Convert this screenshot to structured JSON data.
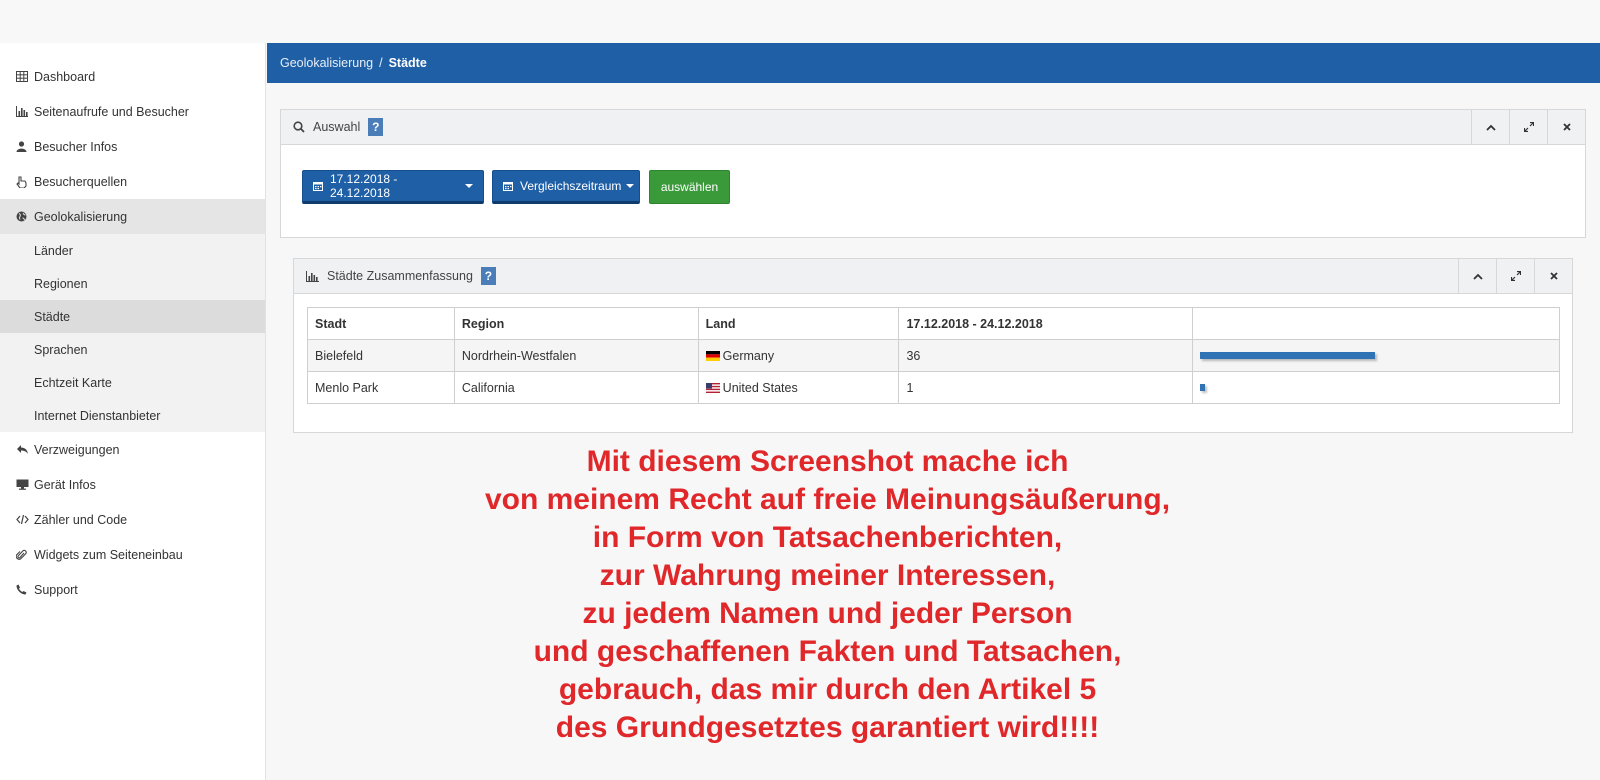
{
  "sidebar": {
    "items": [
      {
        "label": "Dashboard",
        "icon": "table-icon"
      },
      {
        "label": "Seitenaufrufe und Besucher",
        "icon": "bar-chart-icon"
      },
      {
        "label": "Besucher Infos",
        "icon": "user-icon"
      },
      {
        "label": "Besucherquellen",
        "icon": "hand-pointer-icon"
      },
      {
        "label": "Geolokalisierung",
        "icon": "globe-icon"
      }
    ],
    "subitems": [
      {
        "label": "Länder"
      },
      {
        "label": "Regionen"
      },
      {
        "label": "Städte"
      },
      {
        "label": "Sprachen"
      },
      {
        "label": "Echtzeit Karte"
      },
      {
        "label": "Internet Dienstanbieter"
      }
    ],
    "items2": [
      {
        "label": "Verzweigungen",
        "icon": "reply-all-icon"
      },
      {
        "label": "Gerät Infos",
        "icon": "desktop-icon"
      },
      {
        "label": "Zähler und Code",
        "icon": "code-icon"
      },
      {
        "label": "Widgets zum Seiteneinbau",
        "icon": "paperclip-icon"
      },
      {
        "label": "Support",
        "icon": "phone-icon"
      }
    ]
  },
  "breadcrumb": {
    "parent": "Geolokalisierung",
    "separator": "/",
    "current": "Städte"
  },
  "auswahl_panel": {
    "title": "Auswahl",
    "help": "?",
    "date_range_button": "17.12.2018 - 24.12.2018",
    "compare_button": "Vergleichszeitraum",
    "select_button": "auswählen"
  },
  "summary_panel": {
    "title": "Städte Zusammenfassung",
    "help": "?",
    "columns": [
      "Stadt",
      "Region",
      "Land",
      "17.12.2018 - 24.12.2018",
      ""
    ],
    "rows": [
      {
        "stadt": "Bielefeld",
        "region": "Nordrhein-Westfalen",
        "land": "Germany",
        "flag": "germany-flag-icon",
        "count": "36",
        "bar_fraction": 1.0
      },
      {
        "stadt": "Menlo Park",
        "region": "California",
        "land": "United States",
        "flag": "usa-flag-icon",
        "count": "1",
        "bar_fraction": 0.028
      }
    ]
  },
  "overlay_text": {
    "lines": [
      "Mit diesem Screenshot mache ich",
      "von meinem Recht auf freie Meinungsäußerung,",
      "in Form von Tatsachenberichten,",
      "zur Wahrung meiner Interessen,",
      "zu jedem Namen und jeder Person",
      "und geschaffenen Fakten und Tatsachen,",
      "gebrauch, das mir durch den Artikel 5",
      "des Grundgesetztes garantiert wird!!!!"
    ],
    "color": "#e0282b"
  },
  "colors": {
    "primary": "#1f5fa6",
    "success": "#3a9a3a",
    "bar": "#2f73b5"
  }
}
